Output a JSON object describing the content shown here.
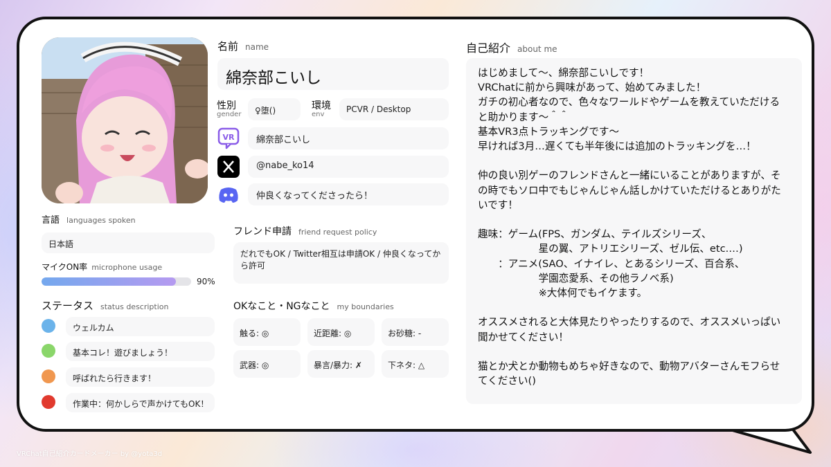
{
  "name": {
    "label": "名前",
    "label_en": "name",
    "value": "綿奈部こいし"
  },
  "gender": {
    "label": "性別",
    "label_en": "gender",
    "value": "♀堕()"
  },
  "env": {
    "label": "環境",
    "label_en": "env",
    "value": "PCVR / Desktop"
  },
  "accounts": {
    "vrchat": {
      "icon": "vrchat-icon",
      "value": "綿奈部こいし"
    },
    "x": {
      "icon": "x-icon",
      "value": "@nabe_ko14"
    },
    "discord": {
      "icon": "discord-icon",
      "value": "仲良くなってくださったら！"
    }
  },
  "languages": {
    "label": "言語",
    "label_en": "languages spoken",
    "value": "日本語"
  },
  "microphone": {
    "label": "マイクON率",
    "label_en": "microphone usage",
    "value_text": "90%",
    "value": 0.9
  },
  "status": {
    "label": "ステータス",
    "label_en": "status description",
    "items": [
      {
        "color": "#6bb3ea",
        "text": "ウェルカム"
      },
      {
        "color": "#8ad66a",
        "text": "基本コレ！遊びましょう！"
      },
      {
        "color": "#f0974f",
        "text": "呼ばれたら行きます！"
      },
      {
        "color": "#e13a2e",
        "text": "作業中：何かしらで声かけてもOK！"
      }
    ]
  },
  "friend_request": {
    "label": "フレンド申請",
    "label_en": "friend request policy",
    "value": "だれでもOK / Twitter相互は申請OK / 仲良くなってから許可"
  },
  "boundaries": {
    "label": "OKなこと・NGなこと",
    "label_en": "my boundaries",
    "items": [
      "触る: ◎",
      "近距離: ◎",
      "お砂糖: -",
      "武器: ◎",
      "暴言/暴力: ✗",
      "下ネタ: △"
    ]
  },
  "about": {
    "label": "自己紹介",
    "label_en": "about me",
    "text": "はじめまして〜、綿奈部こいしです！\nVRChatに前から興味があって、始めてみました！\nガチの初心者なので、色々なワールドやゲームを教えていただけると助かります〜＾＾\n基本VR3点トラッキングです〜\n早ければ3月…遅くても半年後には追加のトラッキングを…！\n\n仲の良い別ゲーのフレンドさんと一緒にいることがありますが、その時でもソロ中でもじゃんじゃん話しかけていただけるとありがたいです！\n\n趣味：ゲーム(FPS、ガンダム、テイルズシリーズ、\n　　　　　　星の翼、アトリエシリーズ、ゼル伝、etc.…)\n　　：アニメ(SAO、イナイレ、とあるシリーズ、百合系、\n　　　　　　学園恋愛系、その他ラノベ系)\n　　　　　　※大体何でもイケます。\n\nオススメされると大体見たりやったりするので、オススメいっぱい聞かせてください！\n\n猫とか犬とか動物もめちゃ好きなので、動物アバターさんモフらせてください()"
  },
  "footer": "VRChat自己紹介カードメーカー by @yota3d",
  "colors": {
    "mic_bar_start": "#74a8ee",
    "mic_bar_end": "#b59af0",
    "discord": "#5865f2",
    "vrchat": "#8a5ce8"
  }
}
